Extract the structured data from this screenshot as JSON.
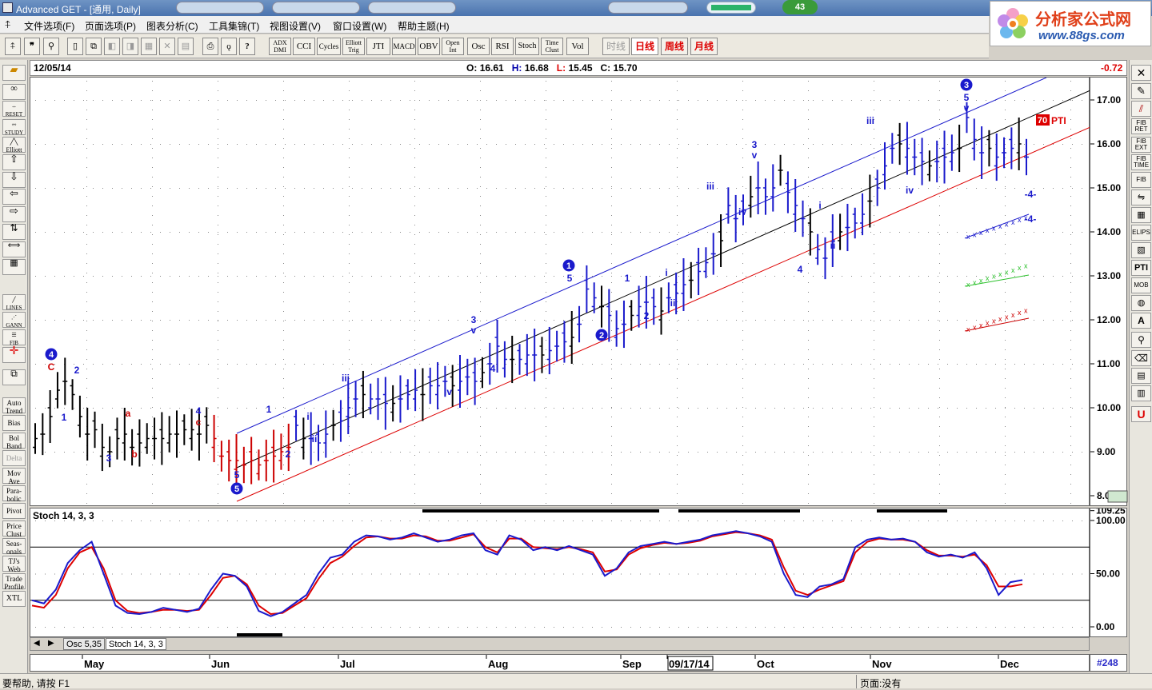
{
  "window": {
    "title": "Advanced GET - [通用, Daily]",
    "badge": "43"
  },
  "logo": {
    "cn": "分析家公式网",
    "url": "www.88gs.com"
  },
  "menu": [
    "文件选项(F)",
    "页面选项(P)",
    "图表分析(C)",
    "工具集锦(T)",
    "视图设置(V)",
    "窗口设置(W)",
    "帮助主题(H)"
  ],
  "toolbar": {
    "indicators": [
      "ADX\nDMI",
      "CCI",
      "Cycles",
      "Elliott\nTrig",
      "JTI",
      "MACD",
      "OBV",
      "Open\nInt",
      "Osc",
      "RSI",
      "Stoch",
      "Time\nClust",
      "Vol"
    ],
    "periods": [
      "时线",
      "日线",
      "周线",
      "月线"
    ]
  },
  "left_tools": [
    "RESET",
    "STUDY",
    "Elliott",
    "LINES",
    "GANN",
    "FIB",
    "Auto\nTrend",
    "Bias",
    "Bol\nBand",
    "Delta",
    "Mov\nAve",
    "Para-\nbolic",
    "Pivot",
    "Price\nClust",
    "Seas-\nonals",
    "TJ's\nWeb",
    "Trade\nProfile",
    "XTL"
  ],
  "right_tools": [
    "FIB\nRET",
    "FIB\nEXT",
    "FIB\nTIME",
    "FIB",
    "ELIPS",
    "PTI",
    "MOB"
  ],
  "info": {
    "date": "12/05/14",
    "open_label": "O:",
    "open": "16.61",
    "high_label": "H:",
    "high": "16.68",
    "low_label": "L:",
    "low": "15.45",
    "close_label": "C:",
    "close": "15.70",
    "change": "-0.72"
  },
  "price_axis": [
    "17.00",
    "16.00",
    "15.00",
    "14.00",
    "13.00",
    "12.00",
    "11.00",
    "10.00",
    "9.00",
    "8.00"
  ],
  "osc_axis": [
    "109.25",
    "100.00",
    "50.00",
    "0.00"
  ],
  "oscillator": {
    "label": "Stoch 14, 3, 3"
  },
  "osc_tabs": [
    "Osc 5,35",
    "Stoch 14, 3, 3"
  ],
  "date_axis": [
    "May",
    "Jun",
    "Jul",
    "Aug",
    "Sep",
    "09/17/14",
    "Oct",
    "Nov",
    "Dec"
  ],
  "bar_number": "#248",
  "pti": {
    "value": "70",
    "label": "PTI"
  },
  "status": {
    "help": "要帮助, 请按 F1",
    "page": "页面:没有"
  },
  "wave_labels": {
    "major": [
      "4",
      "5",
      "1",
      "2",
      "3"
    ],
    "minor": [
      "C",
      "1",
      "2",
      "3",
      "a",
      "b",
      "4",
      "c",
      "5",
      "1",
      "2",
      "i",
      "ii",
      "iii",
      "iv",
      "3",
      "v",
      "4",
      "5",
      "1",
      "2",
      "i",
      "ii",
      "iii",
      "iv",
      "3",
      "v",
      "4",
      "i",
      "ii",
      "iii",
      "iv",
      "5",
      "v",
      "-4-",
      "-4-"
    ]
  },
  "chart_data": {
    "type": "ohlc",
    "title": "",
    "ylim": [
      8,
      17.6
    ],
    "price_series": [
      9.3,
      9.4,
      9.8,
      10.4,
      10.6,
      10.3,
      9.8,
      9.4,
      9.5,
      9.1,
      9.0,
      9.3,
      9.4,
      9.1,
      9.2,
      9.3,
      9.3,
      9.3,
      9.4,
      9.4,
      9.5,
      9.5,
      9.4,
      9.6,
      9.3,
      8.9,
      8.8,
      8.8,
      8.7,
      8.8,
      8.7,
      8.8,
      8.9,
      9.0,
      9.1,
      9.6,
      9.3,
      9.3,
      9.2,
      9.4,
      9.6,
      9.7,
      10.0,
      10.2,
      10.3,
      10.2,
      10.2,
      10.1,
      10.1,
      10.2,
      10.3,
      10.4,
      10.3,
      10.5,
      10.5,
      10.6,
      10.5,
      10.6,
      10.7,
      10.6,
      10.8,
      11.0,
      11.4,
      11.1,
      11.1,
      11.1,
      11.2,
      11.2,
      11.2,
      11.3,
      11.4,
      11.5,
      11.6,
      11.9,
      12.7,
      12.5,
      12.3,
      12.1,
      11.8,
      11.9,
      12.1,
      12.3,
      12.4,
      12.3,
      12.2,
      12.5,
      12.6,
      12.8,
      12.9,
      13.1,
      13.3,
      13.5,
      13.8,
      14.6,
      14.3,
      14.5,
      14.8,
      15.0,
      14.8,
      15.0,
      15.4,
      14.9,
      14.6,
      14.3,
      14.0,
      13.6,
      13.4,
      13.8,
      14.0,
      14.1,
      14.2,
      14.4,
      14.7,
      15.0,
      15.5,
      15.9,
      16.0,
      15.9,
      15.7,
      15.6,
      15.5,
      15.6,
      15.7,
      15.8,
      15.9,
      16.6,
      16.1,
      15.8,
      15.9,
      15.7,
      15.8,
      15.9,
      16.0,
      15.7
    ],
    "stoch_k": [
      25,
      22,
      35,
      60,
      72,
      80,
      50,
      20,
      13,
      12,
      14,
      18,
      16,
      14,
      17,
      35,
      50,
      48,
      38,
      15,
      10,
      14,
      22,
      30,
      50,
      65,
      68,
      80,
      86,
      85,
      82,
      84,
      88,
      84,
      80,
      82,
      86,
      88,
      72,
      68,
      86,
      82,
      72,
      75,
      72,
      76,
      72,
      68,
      48,
      55,
      70,
      76,
      78,
      80,
      78,
      80,
      82,
      86,
      88,
      90,
      88,
      85,
      80,
      50,
      30,
      28,
      38,
      40,
      45,
      75,
      82,
      84,
      82,
      83,
      80,
      70,
      66,
      68,
      65,
      70,
      55,
      30,
      42,
      44
    ],
    "stoch_d": [
      20,
      18,
      30,
      55,
      70,
      75,
      55,
      25,
      15,
      13,
      14,
      16,
      16,
      15,
      16,
      30,
      46,
      48,
      40,
      20,
      12,
      13,
      20,
      27,
      45,
      60,
      66,
      76,
      84,
      85,
      83,
      83,
      86,
      85,
      81,
      81,
      84,
      87,
      75,
      70,
      83,
      83,
      75,
      74,
      73,
      75,
      73,
      70,
      52,
      54,
      68,
      74,
      77,
      79,
      78,
      79,
      81,
      85,
      87,
      89,
      88,
      86,
      82,
      56,
      34,
      30,
      35,
      39,
      43,
      70,
      80,
      83,
      82,
      82,
      80,
      72,
      67,
      67,
      66,
      68,
      58,
      38,
      38,
      40
    ]
  }
}
